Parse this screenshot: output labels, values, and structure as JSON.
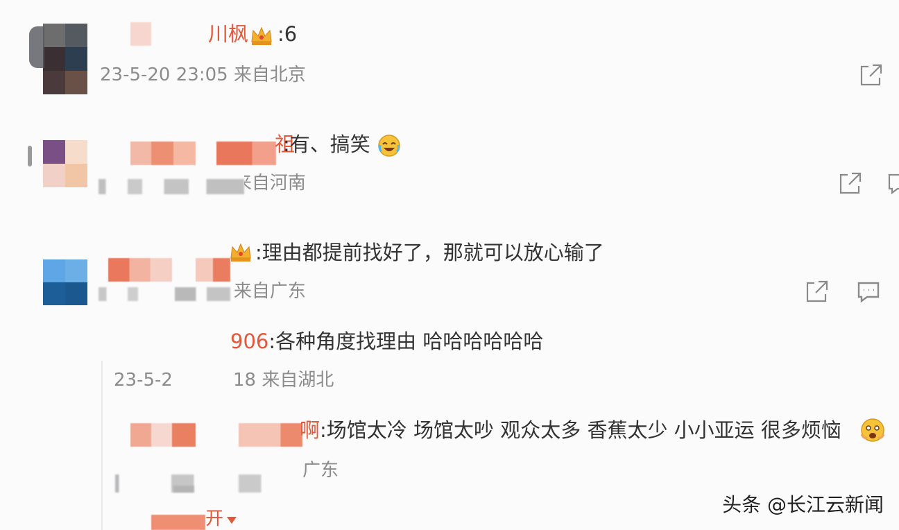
{
  "comments": [
    {
      "handle_suffix": "川枫",
      "text": ":6",
      "meta": "23-5-20 23:05 来自北京"
    },
    {
      "handle_suffix": "祖",
      "text": ":有、搞笑",
      "meta": "23-5-20 23:05 来自河南"
    },
    {
      "text": ":理由都提前找好了，那就可以放心输了",
      "meta": "23-5-20 23:06 来自广东"
    }
  ],
  "replies": [
    {
      "handle_suffix": "906",
      "text": ":各种角度找理由 哈哈哈哈哈哈",
      "meta_prefix": "23-5-2",
      "meta_suffix": "18 来自湖北"
    },
    {
      "handle_suffix": "啊",
      "text": ":场馆太冷 场馆太吵 观众太多 香蕉太少 小小亚运 很多烦恼",
      "meta": "广东"
    }
  ],
  "expand_label": "展开",
  "icons": [
    "share-icon",
    "comment-icon",
    "crown-icon",
    "laugh-cry-emoji",
    "scared-emoji",
    "dropdown-triangle-icon"
  ],
  "watermark": "头条 @长江云新闻",
  "colors": {
    "accent": "#e4583a",
    "meta_text": "#8c8c8c",
    "body_text": "#333333"
  }
}
